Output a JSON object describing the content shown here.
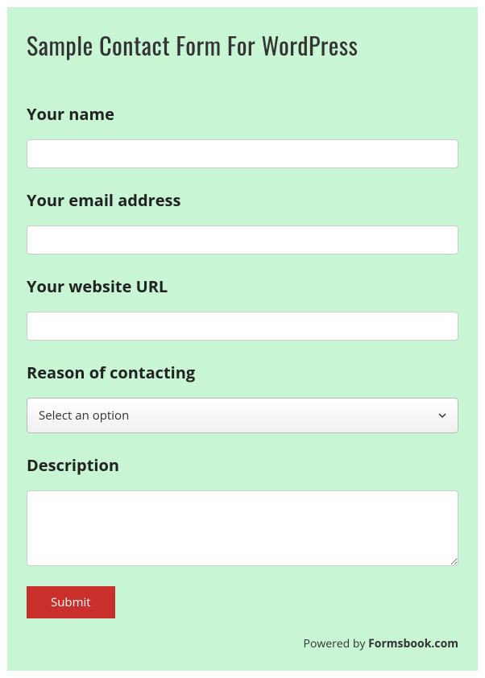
{
  "title": "Sample Contact Form For WordPress",
  "fields": {
    "name": {
      "label": "Your name",
      "value": ""
    },
    "email": {
      "label": "Your email address",
      "value": ""
    },
    "url": {
      "label": "Your website URL",
      "value": ""
    },
    "reason": {
      "label": "Reason of contacting",
      "selected": "Select an option"
    },
    "description": {
      "label": "Description",
      "value": ""
    }
  },
  "buttons": {
    "submit": "Submit"
  },
  "footer": {
    "text": "Powered by ",
    "link": "Formsbook.com"
  }
}
